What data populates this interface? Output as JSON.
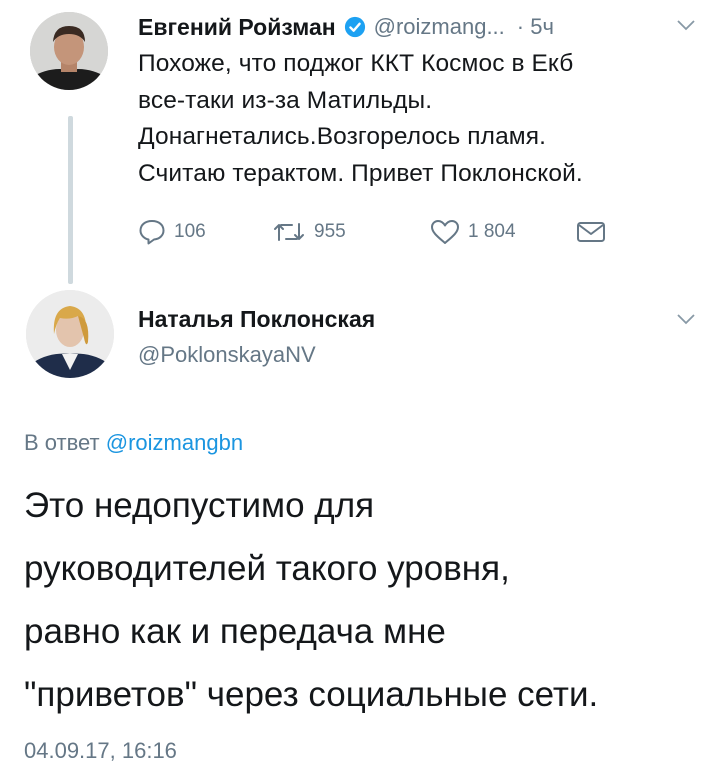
{
  "tweet1": {
    "author_name": "Евгений Ройзман",
    "handle": "@roizmang...",
    "time": "· 5ч",
    "text_lines": [
      "Похоже, что поджог ККТ Космос в Екб",
      "все-таки из-за Матильды.",
      "Донагнетались.Возгорелось пламя.",
      "Считаю терактом. Привет Поклонской."
    ],
    "actions": {
      "replies": "106",
      "retweets": "955",
      "likes": "1 804"
    }
  },
  "tweet2": {
    "author_name": "Наталья Поклонская",
    "handle": "@PoklonskayaNV",
    "reply_prefix": "В ответ",
    "reply_handle": "@roizmangbn",
    "text_lines": [
      "Это недопустимо для",
      "руководителей такого уровня,",
      "равно как и передача мне",
      "\"приветов\" через социальные сети."
    ],
    "timestamp": "04.09.17, 16:16"
  },
  "colors": {
    "text": "#14171a",
    "muted": "#657786",
    "link": "#1b95e0",
    "verified": "#1da1f2",
    "thread_line": "#cfd9de"
  },
  "icons": [
    "verified-badge-icon",
    "chevron-down-icon",
    "reply-icon",
    "retweet-icon",
    "like-icon",
    "direct-message-icon"
  ]
}
